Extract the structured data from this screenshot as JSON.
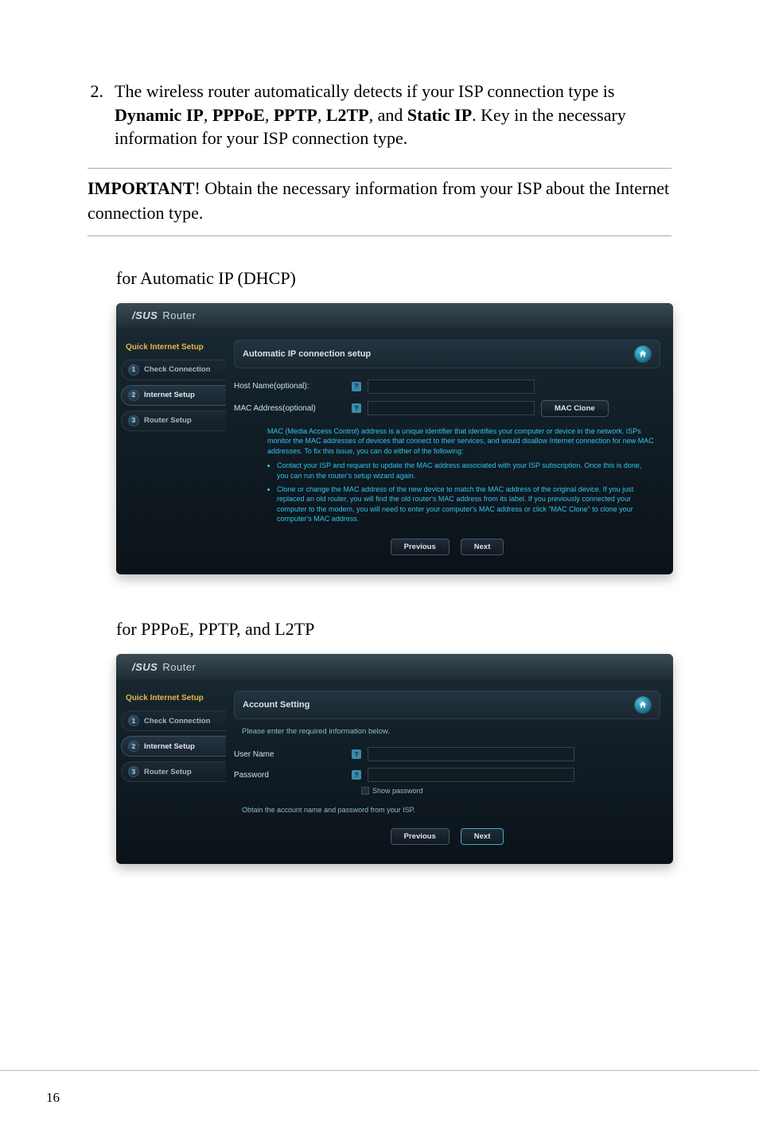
{
  "step": {
    "number": "2.",
    "text_before_bold": "The wireless router automatically detects if your ISP connection type is ",
    "b1": "Dynamic IP",
    "b2": "PPPoE",
    "b3": "PPTP",
    "b4": "L2TP",
    "b5": "Static IP",
    "text_after_bold": ". Key in the necessary information for your ISP connection type."
  },
  "important": {
    "label": "IMPORTANT",
    "text": "!       Obtain the necessary information from your ISP about the Internet connection type."
  },
  "heading1": "for Automatic IP (DHCP)",
  "heading2": "for PPPoE, PPTP, and L2TP",
  "asus": {
    "brand": "/SUS",
    "router": "Router",
    "qis": "Quick Internet Setup",
    "tabs": {
      "check": "Check Connection",
      "internet": "Internet Setup",
      "router": "Router Setup"
    },
    "home_alt": "home"
  },
  "panel1": {
    "title": "Automatic IP connection setup",
    "host_label": "Host Name(optional):",
    "mac_label": "MAC Address(optional)",
    "mac_clone": "MAC Clone",
    "para": "MAC (Media Access Control) address is a unique identifier that identifies your computer or device in the network. ISPs monitor the MAC addresses of devices that connect to their services, and would disallow Internet connection for new MAC addresses. To fix this issue, you can do either of the following:",
    "li1": "Contact your ISP and request to update the MAC address associated with your ISP subscription. Once this is done, you can run the router's setup wizard again.",
    "li2": "Clone or change the MAC address of the new device to match the MAC address of the original device. If you just replaced an old router, you will find the old router's MAC address from its label. If you previously connected your computer to the modem, you will need to enter your computer's MAC address or click \"MAC Clone\" to clone your computer's MAC address.",
    "previous": "Previous",
    "next": "Next"
  },
  "panel2": {
    "title": "Account Setting",
    "instruction": "Please enter the required information below.",
    "user_label": "User Name",
    "pass_label": "Password",
    "show_password": "Show password",
    "isp_note": "Obtain the account name and password from your ISP.",
    "previous": "Previous",
    "next": "Next"
  },
  "page_number": "16",
  "chart_data": null
}
